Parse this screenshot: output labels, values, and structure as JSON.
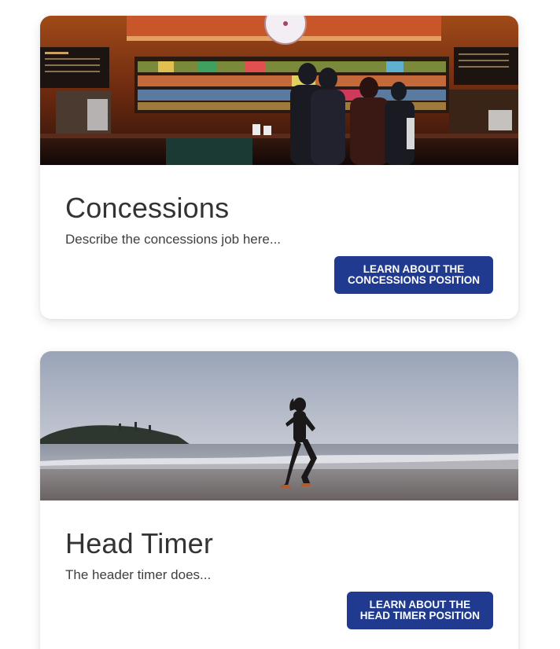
{
  "cards": [
    {
      "title": "Concessions",
      "description": "Describe the concessions job here...",
      "button_line1": "LEARN ABOUT THE",
      "button_line2": "CONCESSIONS POSITION",
      "image_alt": "concession-stand-photo"
    },
    {
      "title": "Head Timer",
      "description": "The header timer does...",
      "button_line1": "LEARN ABOUT THE",
      "button_line2": "HEAD TIMER POSITION",
      "image_alt": "beach-runner-photo"
    }
  ],
  "colors": {
    "button_bg": "#1f3a8f",
    "button_text": "#ffffff",
    "title_text": "#333333",
    "card_bg": "#ffffff"
  }
}
